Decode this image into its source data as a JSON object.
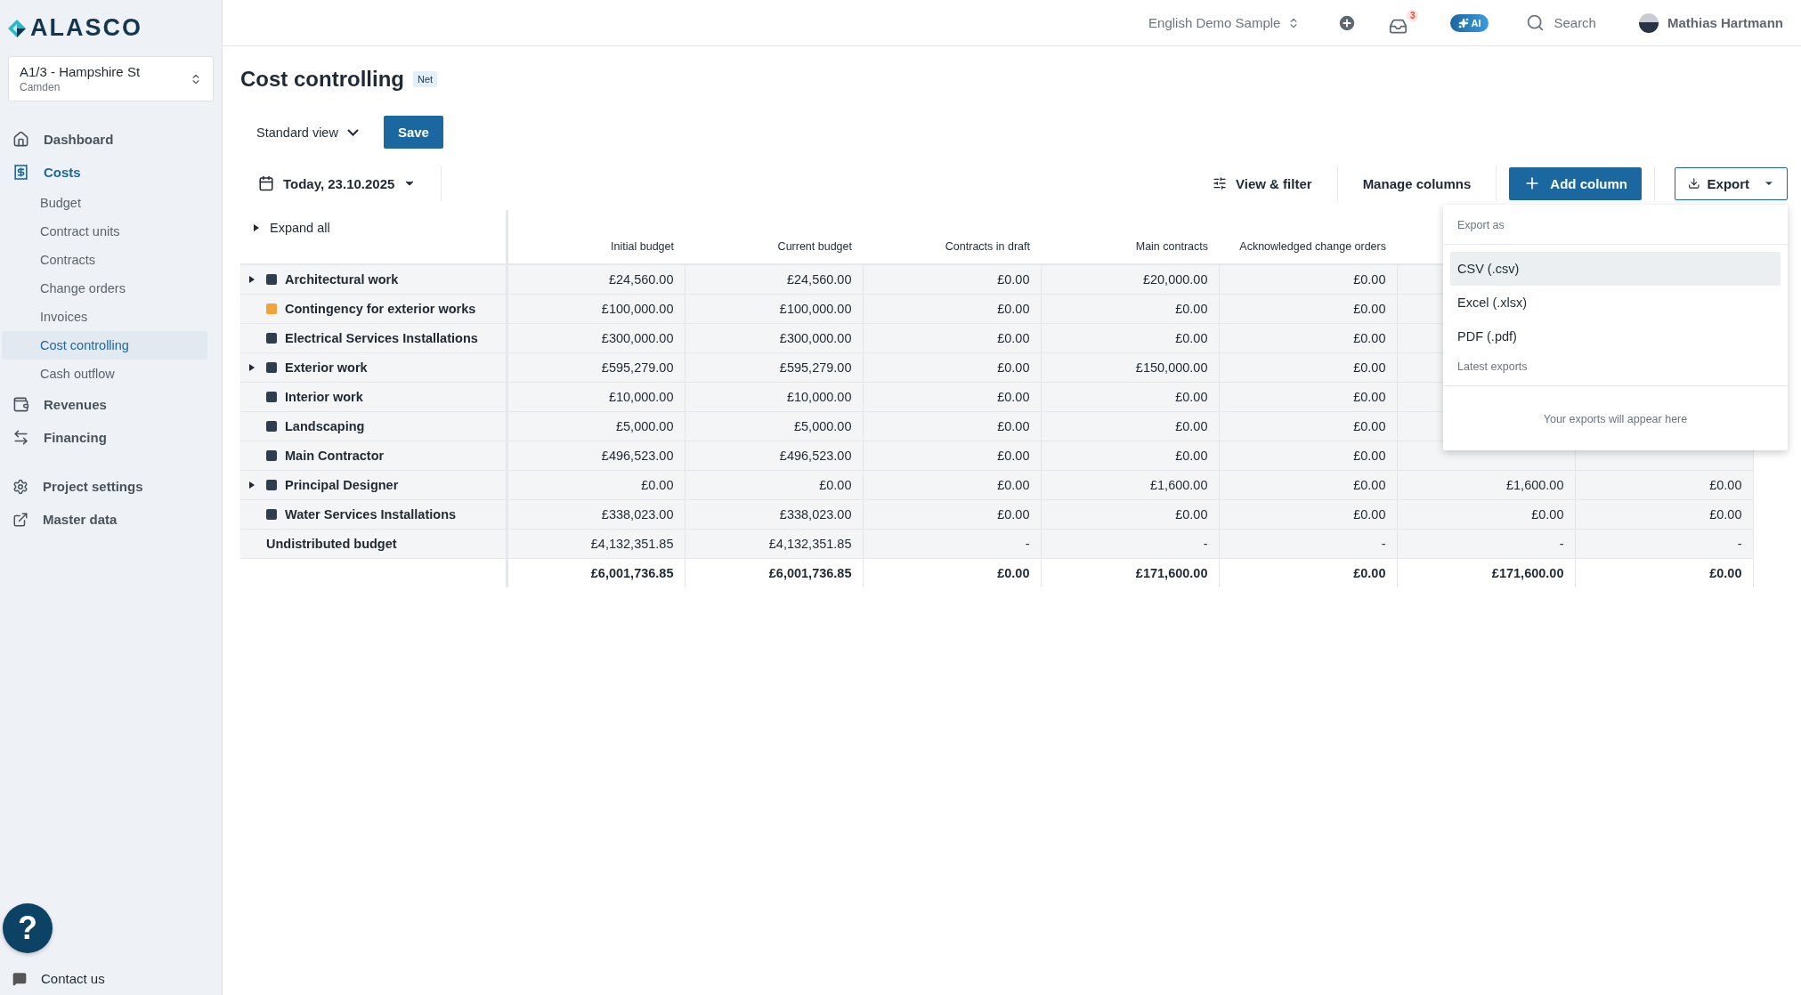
{
  "logo": {
    "text": "ALASCO"
  },
  "project": {
    "name": "A1/3 - Hampshire St",
    "location": "Camden"
  },
  "nav": [
    {
      "label": "Dashboard",
      "active": false
    },
    {
      "label": "Costs",
      "active": true,
      "children": [
        {
          "label": "Budget",
          "selected": false
        },
        {
          "label": "Contract units",
          "selected": false
        },
        {
          "label": "Contracts",
          "selected": false
        },
        {
          "label": "Change orders",
          "selected": false
        },
        {
          "label": "Invoices",
          "selected": false
        },
        {
          "label": "Cost controlling",
          "selected": true
        },
        {
          "label": "Cash outflow",
          "selected": false
        }
      ]
    },
    {
      "label": "Revenues",
      "active": false
    },
    {
      "label": "Financing",
      "active": false
    }
  ],
  "nav_bottom": [
    {
      "label": "Project settings"
    },
    {
      "label": "Master data"
    }
  ],
  "help": {
    "label": "?"
  },
  "contact": {
    "label": "Contact us"
  },
  "topbar": {
    "workspace": "English Demo Sample",
    "notifications": "3",
    "ai": "AI",
    "search": "Search",
    "user": "Mathias Hartmann"
  },
  "page": {
    "title": "Cost controlling",
    "badge": "Net"
  },
  "view": {
    "label": "Standard view",
    "save": "Save"
  },
  "date": {
    "label": "Today, 23.10.2025"
  },
  "toolbar": {
    "filter": "View & filter",
    "manage": "Manage columns",
    "add": "Add column",
    "export": "Export"
  },
  "export_menu": {
    "open": true,
    "heading": "Export as",
    "options": [
      {
        "label": "CSV (.csv)",
        "highlighted": true
      },
      {
        "label": "Excel (.xlsx)",
        "highlighted": false
      },
      {
        "label": "PDF (.pdf)",
        "highlighted": false
      }
    ],
    "latest_heading": "Latest exports",
    "empty": "Your exports will appear here"
  },
  "table": {
    "expand_all": "Expand all",
    "columns": [
      "Initial budget",
      "Current budget",
      "Contracts in draft",
      "Main contracts",
      "Acknowledged change orders",
      null,
      null
    ],
    "rows": [
      {
        "kind": "category",
        "label": "Architectural work",
        "color": "#2e3d4f",
        "expandable": true,
        "cells": [
          "£24,560.00",
          "£24,560.00",
          "£0.00",
          "£20,000.00",
          "£0.00",
          null,
          null
        ]
      },
      {
        "kind": "category",
        "label": "Contingency for exterior works",
        "color": "#f2a23a",
        "expandable": false,
        "cells": [
          "£100,000.00",
          "£100,000.00",
          "£0.00",
          "£0.00",
          "£0.00",
          null,
          null
        ]
      },
      {
        "kind": "category",
        "label": "Electrical Services Installations",
        "color": "#2e3d4f",
        "expandable": false,
        "cells": [
          "£300,000.00",
          "£300,000.00",
          "£0.00",
          "£0.00",
          "£0.00",
          null,
          null
        ]
      },
      {
        "kind": "category",
        "label": "Exterior work",
        "color": "#2e3d4f",
        "expandable": true,
        "cells": [
          "£595,279.00",
          "£595,279.00",
          "£0.00",
          "£150,000.00",
          "£0.00",
          null,
          null
        ]
      },
      {
        "kind": "category",
        "label": "Interior work",
        "color": "#2e3d4f",
        "expandable": false,
        "cells": [
          "£10,000.00",
          "£10,000.00",
          "£0.00",
          "£0.00",
          "£0.00",
          null,
          null
        ]
      },
      {
        "kind": "category",
        "label": "Landscaping",
        "color": "#2e3d4f",
        "expandable": false,
        "cells": [
          "£5,000.00",
          "£5,000.00",
          "£0.00",
          "£0.00",
          "£0.00",
          null,
          null
        ]
      },
      {
        "kind": "category",
        "label": "Main Contractor",
        "color": "#2e3d4f",
        "expandable": false,
        "cells": [
          "£496,523.00",
          "£496,523.00",
          "£0.00",
          "£0.00",
          "£0.00",
          null,
          null
        ]
      },
      {
        "kind": "category",
        "label": "Principal Designer",
        "color": "#2e3d4f",
        "expandable": true,
        "cells": [
          "£0.00",
          "£0.00",
          "£0.00",
          "£1,600.00",
          "£0.00",
          "£1,600.00",
          "£0.00"
        ]
      },
      {
        "kind": "category",
        "label": "Water Services Installations",
        "color": "#2e3d4f",
        "expandable": false,
        "cells": [
          "£338,023.00",
          "£338,023.00",
          "£0.00",
          "£0.00",
          "£0.00",
          "£0.00",
          "£0.00"
        ]
      },
      {
        "kind": "plain",
        "label": "Undistributed budget",
        "cells": [
          "£4,132,351.85",
          "£4,132,351.85",
          "-",
          "-",
          "-",
          "-",
          "-"
        ]
      },
      {
        "kind": "total",
        "cells": [
          "£6,001,736.85",
          "£6,001,736.85",
          "£0.00",
          "£171,600.00",
          "£0.00",
          "£171,600.00",
          "£0.00"
        ]
      }
    ]
  }
}
